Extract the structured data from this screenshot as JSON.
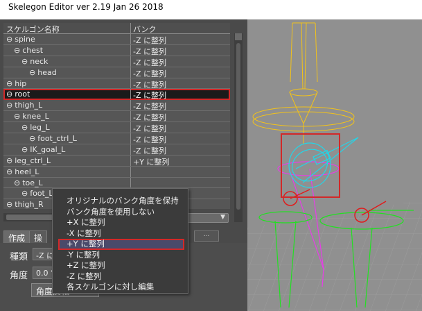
{
  "window": {
    "title": "Skelegon Editor ver 2.19 Jan 26 2018"
  },
  "tree": {
    "columns": {
      "name": "スケルゴン名称",
      "bank": "バンク"
    },
    "rows": [
      {
        "name": "spine",
        "indent": 0,
        "bank": "-Z に整列"
      },
      {
        "name": "chest",
        "indent": 1,
        "bank": "-Z に整列"
      },
      {
        "name": "neck",
        "indent": 2,
        "bank": "-Z に整列"
      },
      {
        "name": "head",
        "indent": 3,
        "bank": "-Z に整列"
      },
      {
        "name": "hip",
        "indent": 0,
        "bank": "-Z に整列"
      },
      {
        "name": "root",
        "indent": 0,
        "bank": "-Z に整列",
        "selected": true
      },
      {
        "name": "thigh_L",
        "indent": 0,
        "bank": "-Z に整列"
      },
      {
        "name": "knee_L",
        "indent": 1,
        "bank": "-Z に整列"
      },
      {
        "name": "leg_L",
        "indent": 2,
        "bank": "-Z に整列"
      },
      {
        "name": "foot_ctrl_L",
        "indent": 3,
        "bank": "-Z に整列"
      },
      {
        "name": "IK_goal_L",
        "indent": 2,
        "bank": "-Z に整列"
      },
      {
        "name": "leg_ctrl_L",
        "indent": 0,
        "bank": "+Y に整列"
      },
      {
        "name": "heel_L",
        "indent": 0,
        "bank": ""
      },
      {
        "name": "toe_L",
        "indent": 1,
        "bank": ""
      },
      {
        "name": "foot_L",
        "indent": 2,
        "bank": ""
      },
      {
        "name": "thigh_R",
        "indent": 0,
        "bank": ""
      }
    ]
  },
  "tabs": [
    {
      "label": "作成"
    },
    {
      "label": "操"
    },
    {
      "label": "..."
    }
  ],
  "form": {
    "type_label": "種類",
    "type_value": "-Z に",
    "angle_label": "角度",
    "angle_value": "0.0 °",
    "flip_button": "角度反転"
  },
  "context_menu": {
    "items": [
      "オリジナルのバンク角度を保持",
      "バンク角度を使用しない",
      "+X に整列",
      "-X に整列",
      "+Y に整列",
      "-Y に整列",
      "+Z に整列",
      "-Z に整列",
      "各スケルゴンに対し編集"
    ],
    "highlighted_index": 4
  },
  "colors": {
    "panel": "#4a4a4a",
    "selection_outline": "#d22828",
    "bone_yellow": "#f2c21a",
    "bone_cyan": "#22d6e8",
    "bone_green": "#22e022",
    "bone_magenta": "#e83ce8",
    "bone_red": "#e01c1c"
  }
}
